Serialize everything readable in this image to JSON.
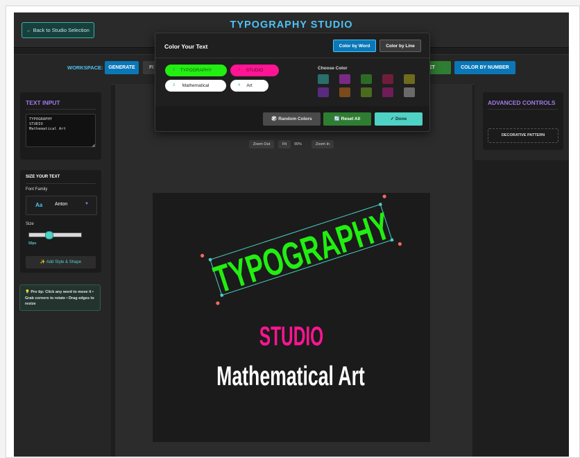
{
  "header": {
    "back_label": "← Back to Studio Selection",
    "title": "TYPOGRAPHY STUDIO"
  },
  "toolbar": {
    "workspace_label": "WORKSPACE:",
    "generate_label": "GENERATE",
    "partial_label": "FI",
    "partial_right_label": "ET",
    "color_by_number_label": "COLOR BY NUMBER"
  },
  "text_input": {
    "title": "TEXT INPUT",
    "value": "TYPOGRAPHY\nSTUDIO\nMathematical Art"
  },
  "size_panel": {
    "title": "SIZE YOUR TEXT",
    "font_family_label": "Font Family",
    "font_icon": "Aa",
    "font_value": "Anton",
    "size_label": "Size",
    "size_value": "50px",
    "size_fraction": 0.35,
    "style_button_label": "✨ Add Style & Shape"
  },
  "pro_tip": {
    "text": "💡 Pro tip: Click any word to move it • Grab corners to rotate • Drag edges to resize"
  },
  "advanced": {
    "title": "ADVANCED CONTROLS",
    "decorative_label": "DECORATIVE PATTERN"
  },
  "zoom": {
    "zoom_out_label": "Zoom Out",
    "fit_label": "Fit",
    "level": "90%",
    "zoom_in_label": "Zoom In"
  },
  "artwork": {
    "line1": "TYPOGRAPHY",
    "line2": "STUDIO",
    "line3": "Mathematical Art",
    "colors": {
      "line1": "#22ee11",
      "line2": "#ff1493",
      "line3": "#ffffff"
    }
  },
  "color_modal": {
    "title": "Color Your Text",
    "by_word_label": "Color by Word",
    "by_line_label": "Color by Line",
    "choose_color_label": "Choose Color",
    "words": [
      {
        "num": "1",
        "label": "TYPOGRAPHY",
        "color": "#22ee11"
      },
      {
        "num": "2",
        "label": "STUDIO",
        "color": "#ff1493"
      },
      {
        "num": "3",
        "label": "Mathematical",
        "color": "#ffffff"
      },
      {
        "num": "4",
        "label": "Art",
        "color": "#ffffff"
      }
    ],
    "swatches": [
      "#2a6e6a",
      "#7b2a84",
      "#2c6b25",
      "#6e1d3a",
      "#6e6a1e",
      "#5a2a80",
      "#7a4a1c",
      "#4a6a1e",
      "#6e1d56",
      "#6a6a6a"
    ],
    "random_label": "🎲 Random Colors",
    "reset_label": "🔄 Reset All",
    "done_label": "✓ Done"
  }
}
